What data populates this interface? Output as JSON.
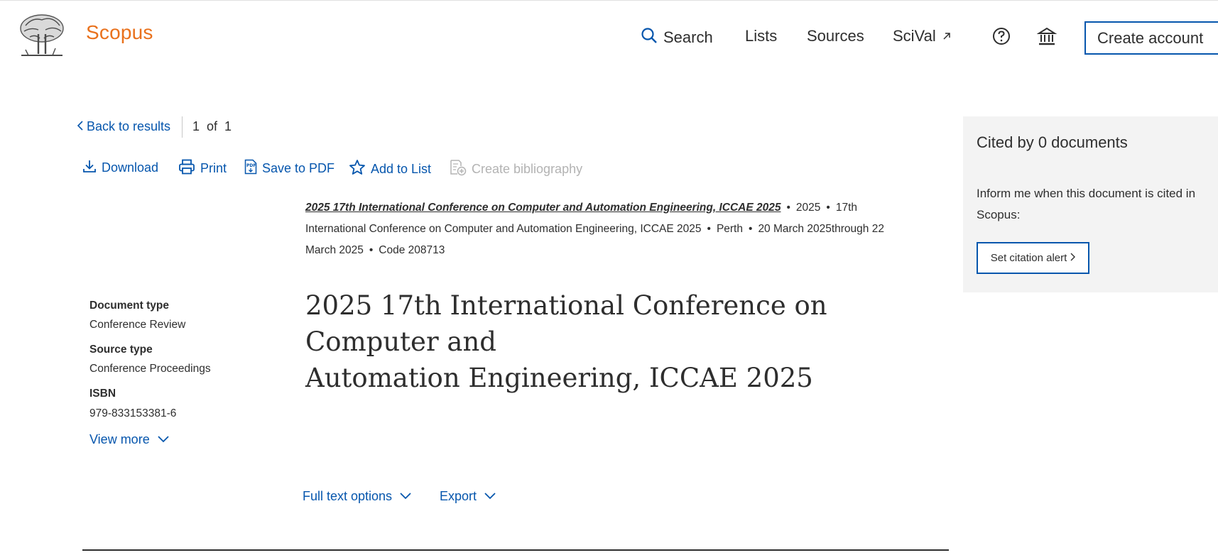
{
  "header": {
    "brand": "Scopus",
    "nav": {
      "search": "Search",
      "lists": "Lists",
      "sources": "Sources",
      "scival": "SciVal"
    },
    "create_account": "Create account",
    "icons": [
      "search-icon",
      "external-link-icon",
      "help-icon",
      "institution-icon"
    ]
  },
  "toolbar": {
    "back": "Back to results",
    "counter": "1  of  1",
    "download": "Download",
    "print": "Print",
    "save_pdf": "Save to PDF",
    "add_to_list": "Add to List",
    "create_bibliography": "Create bibliography"
  },
  "source": {
    "title": "2025 17th International Conference on Computer and Automation Engineering, ICCAE 2025",
    "year": "2025",
    "conference_pre": "17th",
    "conference_rest": "International Conference on Computer and Automation Engineering, ICCAE 2025",
    "location": "Perth",
    "dates_pre": "20 March 2025through 22",
    "dates_rest": "March 2025",
    "code": "Code 208713"
  },
  "metadata": {
    "doc_type_label": "Document type",
    "doc_type_value": "Conference Review",
    "source_type_label": "Source type",
    "source_type_value": "Conference Proceedings",
    "isbn_label": "ISBN",
    "isbn_value": "979-833153381-6",
    "view_more": "View more"
  },
  "document": {
    "title_line1": "2025 17th International Conference on Computer and",
    "title_line2": "Automation Engineering, ICCAE 2025"
  },
  "actions": {
    "full_text": "Full text options",
    "export": "Export"
  },
  "sidebar": {
    "cited_by": "Cited by 0 documents",
    "inform_line1": "Inform me when this document is cited in",
    "inform_line2": "Scopus:",
    "set_alert": "Set citation alert"
  },
  "colors": {
    "brand": "#e9711c",
    "link": "#0656ad",
    "text": "#2e2e2e",
    "panel": "#f3f3f3",
    "disabled": "#b3b3b3"
  }
}
